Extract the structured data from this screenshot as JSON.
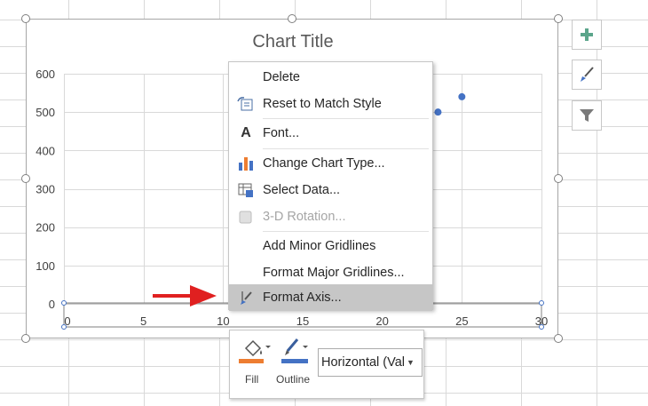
{
  "chart": {
    "title": "Chart Title",
    "y_ticks": [
      "600",
      "500",
      "400",
      "300",
      "200",
      "100",
      "0"
    ],
    "x_ticks": [
      "0",
      "5",
      "10",
      "15",
      "20",
      "25",
      "30"
    ]
  },
  "chart_data": {
    "type": "scatter",
    "title": "Chart Title",
    "xlim": [
      0,
      30
    ],
    "ylim": [
      0,
      600
    ],
    "points": [
      {
        "x": 23.5,
        "y": 500
      },
      {
        "x": 25,
        "y": 540
      }
    ],
    "grid": true
  },
  "side_buttons": [
    {
      "icon": "plus-icon"
    },
    {
      "icon": "brush-icon"
    },
    {
      "icon": "filter-icon"
    }
  ],
  "context_menu": {
    "items": [
      {
        "label": "Delete",
        "icon": "",
        "disabled": false
      },
      {
        "label": "Reset to Match Style",
        "icon": "reset-style-icon",
        "disabled": false
      },
      {
        "label": "Font...",
        "icon": "font-icon",
        "disabled": false
      },
      {
        "label": "Change Chart Type...",
        "icon": "chart-type-icon",
        "disabled": false
      },
      {
        "label": "Select Data...",
        "icon": "select-data-icon",
        "disabled": false
      },
      {
        "label": "3-D Rotation...",
        "icon": "3d-rotation-icon",
        "disabled": true
      },
      {
        "label": "Add Minor Gridlines",
        "icon": "",
        "disabled": false
      },
      {
        "label": "Format Major Gridlines...",
        "icon": "",
        "disabled": false
      },
      {
        "label": "Format Axis...",
        "icon": "format-axis-icon",
        "disabled": false,
        "highlighted": true
      }
    ]
  },
  "mini_toolbar": {
    "fill_label": "Fill",
    "outline_label": "Outline",
    "element_select": "Horizontal (Val",
    "fill_color": "#ed7d31",
    "outline_color": "#4472c4"
  },
  "colors": {
    "point": "#4472c4",
    "arrow": "#e02020",
    "plus": "#5ba58b"
  }
}
